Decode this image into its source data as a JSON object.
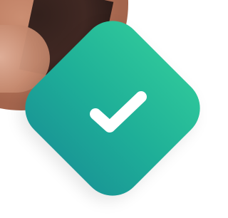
{
  "ui": {
    "badge_color_top": "#2dc59a",
    "badge_color_bottom": "#1a9896",
    "check_color": "#ffffff",
    "icon": "checkmark-icon"
  }
}
